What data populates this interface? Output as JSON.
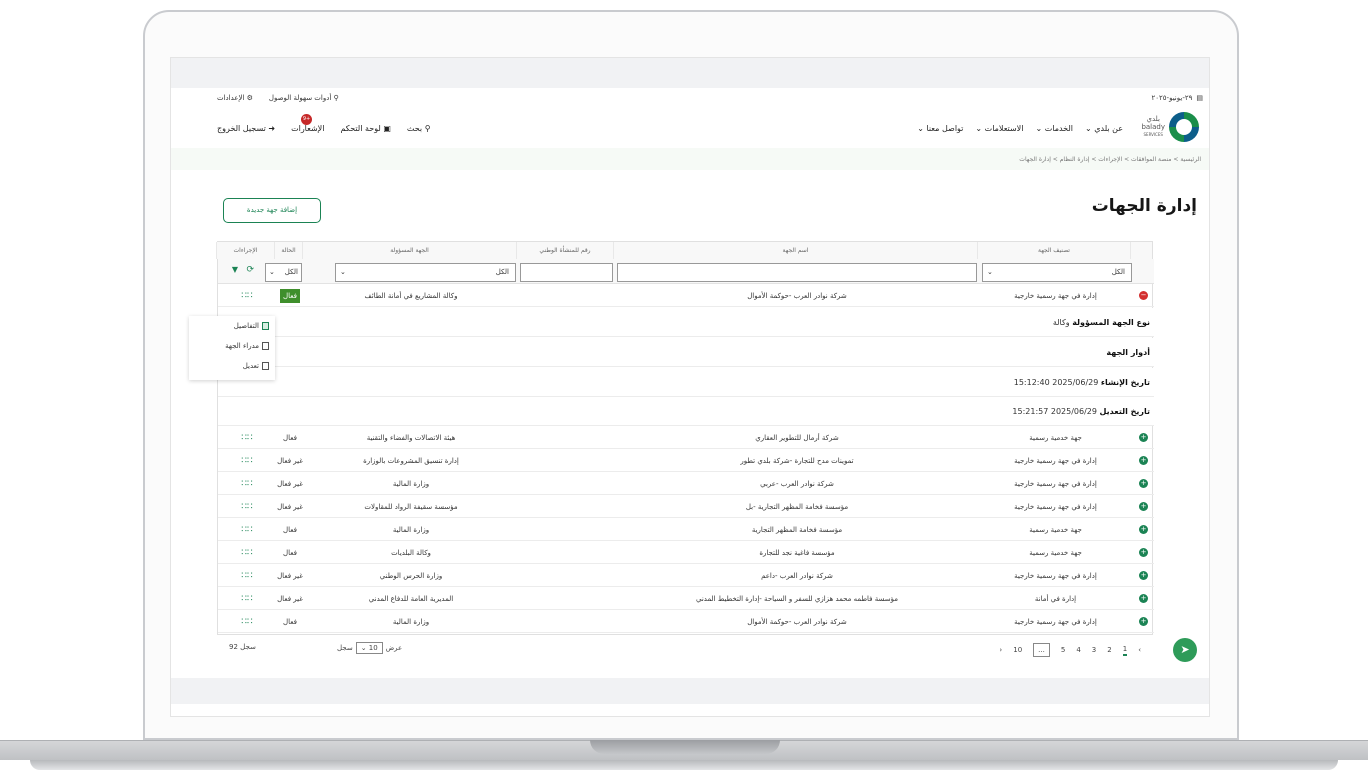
{
  "util": {
    "date": "٢٩-يونيو-٢٠٢٥",
    "settings": "الإعدادات",
    "accessibility": "أدوات سهولة الوصول"
  },
  "nav": {
    "logo_ar": "بلدي",
    "logo_en": "balady",
    "logo_sub": "SERVICES",
    "menu": [
      "عن بلدي",
      "الخدمات",
      "الاستعلامات",
      "تواصل معنا"
    ],
    "search": "بحث",
    "dashboard": "لوحة التحكم",
    "notifications": "الإشعارات",
    "notif_count": "+9",
    "logout": "تسجيل الخروج"
  },
  "breadcrumb": "الرئيسية  >  منصة الموافقات  >  الإجراءات  >  إدارة النظام  >  إدارة الجهات",
  "page_title": "إدارة الجهات",
  "add_button": "إضافة جهة جديدة",
  "table": {
    "headers": {
      "classification": "تصنيف الجهة",
      "name": "اسم الجهة",
      "national_id": "رقم للمنشأة الوطني",
      "responsible": "الجهة المسؤولة",
      "status": "الحالة",
      "actions": "الإجراءات"
    },
    "filter_all": "الكل",
    "filter_all_short": "الكل",
    "expanded_row": {
      "classification": "إدارة في جهة رسمية خارجية",
      "name": "شركة نوادر العرب -حوكمة الأموال",
      "responsible": "وكالة المشاريع في أمانة الطائف",
      "status": "فعال"
    },
    "details": {
      "type_label": "نوع الجهة المسؤولة",
      "type_value": "وكالة",
      "roles_label": "أدوار الجهة",
      "created_label": "تاريخ الإنشاء",
      "created_value": "2025/06/29 15:12:40",
      "modified_label": "تاريخ التعديل",
      "modified_value": "2025/06/29 15:21:57"
    },
    "rows": [
      {
        "classification": "جهة خدمية رسمية",
        "name": "شركة أرمال للتطوير العقاري",
        "responsible": "هيئة الاتصالات والفضاء والتقنية",
        "status": "فعال"
      },
      {
        "classification": "إدارة في جهة رسمية خارجية",
        "name": "تموينات مدح للتجارة -شركة بلدي تطور",
        "responsible": "إدارة تنسيق المشروعات بالوزارة",
        "status": "غير فعال"
      },
      {
        "classification": "إدارة في جهة رسمية خارجية",
        "name": "شركة نوادر العرب -عربي",
        "responsible": "وزارة المالية",
        "status": "غير فعال"
      },
      {
        "classification": "إدارة في جهة رسمية خارجية",
        "name": "مؤسسة فخامة المظهر التجارية -بل",
        "responsible": "مؤسسة سقيفة الرواد للمقاولات",
        "status": "غير فعال"
      },
      {
        "classification": "جهة خدمية رسمية",
        "name": "مؤسسة فخامة المظهر التجارية",
        "responsible": "وزارة المالية",
        "status": "فعال"
      },
      {
        "classification": "جهة خدمية رسمية",
        "name": "مؤسسة فاغية نجد للتجارة",
        "responsible": "وكالة البلديات",
        "status": "فعال"
      },
      {
        "classification": "إدارة في جهة رسمية خارجية",
        "name": "شركة نوادر العرب -داعم",
        "responsible": "وزارة الحرس الوطني",
        "status": "غير فعال"
      },
      {
        "classification": "إدارة في أمانة",
        "name": "مؤسسة فاطمه محمد هزازي للسفر و السياحة -إدارة التخطيط المدني",
        "responsible": "المديرية العامة للدفاع المدني",
        "status": "غير فعال"
      },
      {
        "classification": "إدارة في جهة رسمية خارجية",
        "name": "شركة نوادر العرب -حوكمة الأموال",
        "responsible": "وزارة المالية",
        "status": "فعال"
      }
    ]
  },
  "context_menu": [
    "التفاصيل",
    "مدراء الجهة",
    "تعديل"
  ],
  "footer": {
    "pages": [
      "1",
      "2",
      "3",
      "4",
      "5",
      "...",
      "10"
    ],
    "show": "عرض",
    "per_page": "10",
    "records_word": "سجل",
    "total": "92 سجل"
  }
}
